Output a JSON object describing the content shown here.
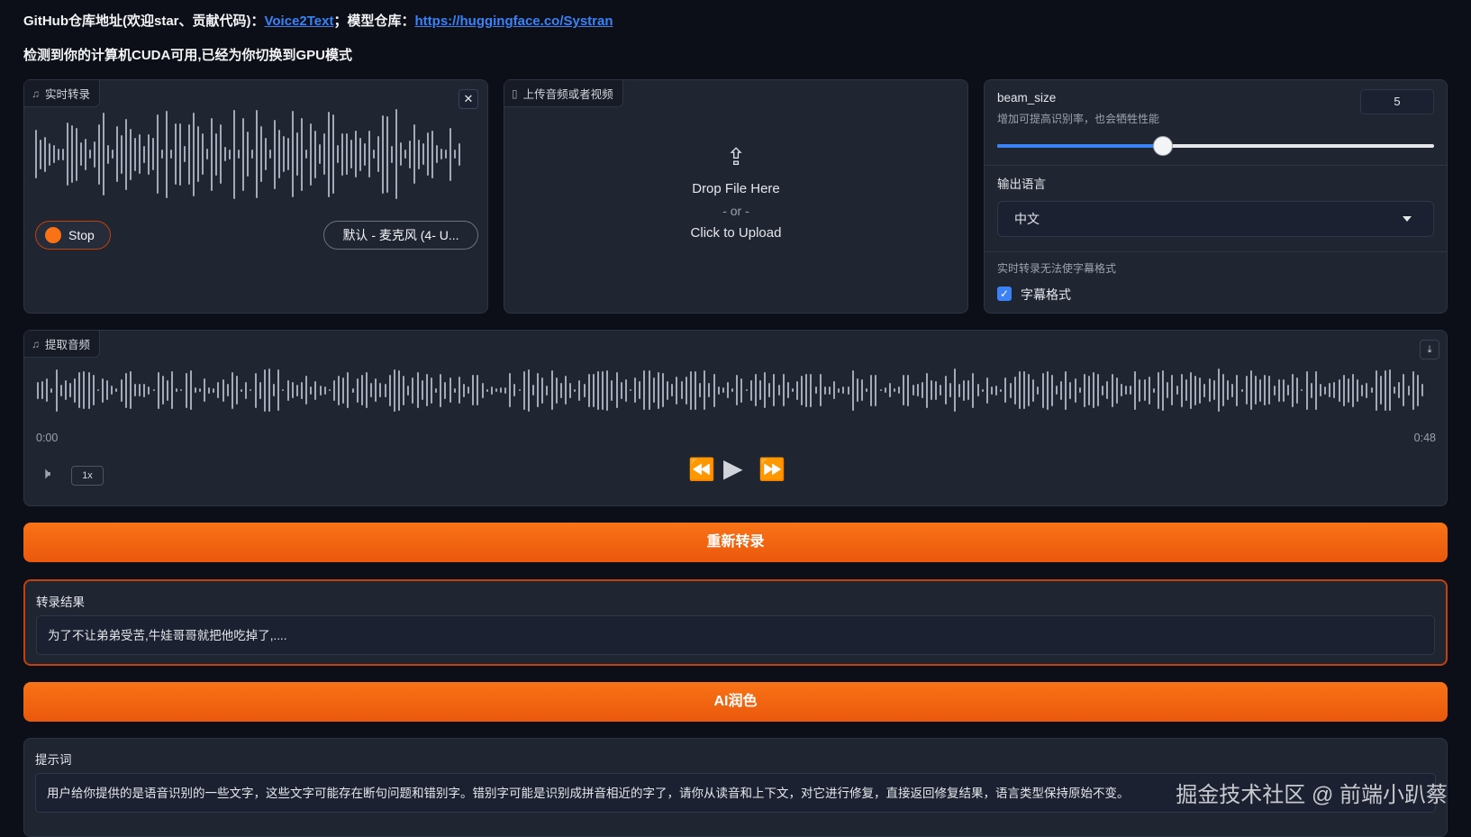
{
  "header": {
    "link_prefix": "GitHub仓库地址(欢迎star、贡献代码)：",
    "repo_link": "Voice2Text",
    "model_prefix": "；模型仓库：",
    "model_link": "https://huggingface.co/Systran",
    "notice": "检测到你的计算机CUDA可用,已经为你切换到GPU模式"
  },
  "live": {
    "title": "实时转录",
    "stop_label": "Stop",
    "mic_label": "默认 - 麦克风 (4- U..."
  },
  "upload": {
    "title": "上传音频或者视频",
    "drop": "Drop File Here",
    "or": "- or -",
    "click": "Click to Upload"
  },
  "settings": {
    "beam_label": "beam_size",
    "beam_info": "增加可提高识别率，也会牺牲性能",
    "beam_value": "5",
    "beam_fraction": 0.38,
    "lang_label": "输出语言",
    "lang_value": "中文",
    "subtitle_info": "实时转录无法使字幕格式",
    "subtitle_label": "字幕格式",
    "subtitle_checked": true
  },
  "audio": {
    "title": "提取音频",
    "time_start": "0:00",
    "time_end": "0:48",
    "rate": "1x"
  },
  "buttons": {
    "retranscribe": "重新转录",
    "polish": "AI润色"
  },
  "result": {
    "label": "转录结果",
    "text": "为了不让弟弟受苦,牛娃哥哥就把他吃掉了,...."
  },
  "prompt": {
    "label": "提示词",
    "text": "用户给你提供的是语音识别的一些文字，这些文字可能存在断句问题和错别字。错别字可能是识别成拼音相近的字了，请你从读音和上下文，对它进行修复，直接返回修复结果，语言类型保持原始不变。"
  },
  "watermark": "掘金技术社区 @ 前端小趴蔡",
  "colors": {
    "accent": "#f97316",
    "link": "#3b82f6",
    "background": "#0c0f17",
    "panel": "#1f2531"
  }
}
